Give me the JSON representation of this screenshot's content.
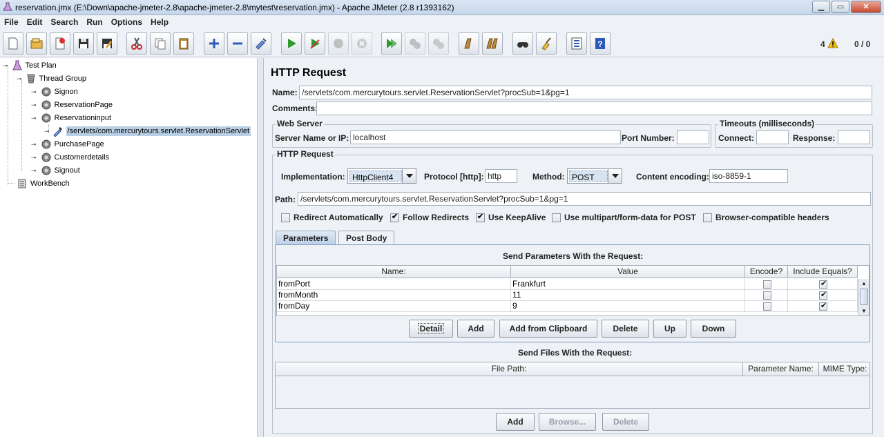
{
  "window": {
    "title": "reservation.jmx (E:\\Down\\apache-jmeter-2.8\\apache-jmeter-2.8\\mytest\\reservation.jmx) - Apache JMeter (2.8 r1393162)",
    "minimize": "▁",
    "maximize": "▭",
    "close": "✕"
  },
  "menu": [
    "File",
    "Edit",
    "Search",
    "Run",
    "Options",
    "Help"
  ],
  "toolbar": {
    "warnings_count": "4",
    "threads_status": "0 / 0",
    "icons": [
      "new-icon",
      "open-icon",
      "close-icon",
      "save-icon",
      "save-as-icon",
      "cut-icon",
      "copy-icon",
      "paste-icon",
      "expand-icon",
      "collapse-icon",
      "toggle-icon",
      "start-icon",
      "start-no-timers-icon",
      "stop-icon",
      "shutdown-icon",
      "remote-start-icon",
      "remote-stop-icon",
      "remote-shutdown-icon",
      "clear-icon",
      "clear-all-icon",
      "search-icon",
      "reset-search-icon",
      "function-helper-icon",
      "help-icon"
    ],
    "accent_green": "#2e9a2e",
    "accent_blue": "#2a5bb8"
  },
  "tree": {
    "items": [
      {
        "label": "Test Plan"
      },
      {
        "label": "Thread Group"
      },
      {
        "label": "Signon"
      },
      {
        "label": "ReservationPage"
      },
      {
        "label": "Reservationinput"
      },
      {
        "label": "/servlets/com.mercurytours.servlet.ReservationServlet"
      },
      {
        "label": "PurchasePage"
      },
      {
        "label": "Customerdetails"
      },
      {
        "label": "Signout"
      },
      {
        "label": "WorkBench"
      }
    ],
    "selected": "/servlets/com.mercurytours.servlet.ReservationServlet"
  },
  "panel": {
    "title": "HTTP Request",
    "name_label": "Name:",
    "name_value": "/servlets/com.mercurytours.servlet.ReservationServlet?procSub=1&pg=1",
    "comments_label": "Comments:",
    "comments_value": "",
    "web_server": {
      "title": "Web Server",
      "server_label": "Server Name or IP:",
      "server_value": "localhost",
      "port_label": "Port Number:",
      "port_value": ""
    },
    "timeouts": {
      "title": "Timeouts (milliseconds)",
      "connect_label": "Connect:",
      "connect_value": "",
      "response_label": "Response:",
      "response_value": ""
    },
    "http_request": {
      "title": "HTTP Request",
      "implementation_label": "Implementation:",
      "implementation_value": "HttpClient4",
      "protocol_label": "Protocol [http]:",
      "protocol_value": "http",
      "method_label": "Method:",
      "method_value": "POST",
      "encoding_label": "Content encoding:",
      "encoding_value": "iso-8859-1",
      "path_label": "Path:",
      "path_value": "/servlets/com.mercurytours.servlet.ReservationServlet?procSub=1&pg=1"
    },
    "options": [
      {
        "label": "Redirect Automatically",
        "checked": false
      },
      {
        "label": "Follow Redirects",
        "checked": true
      },
      {
        "label": "Use KeepAlive",
        "checked": true
      },
      {
        "label": "Use multipart/form-data for POST",
        "checked": false
      },
      {
        "label": "Browser-compatible headers",
        "checked": false
      }
    ],
    "tabs": [
      "Parameters",
      "Post Body"
    ],
    "params": {
      "title": "Send Parameters With the Request:",
      "columns": [
        "Name:",
        "Value",
        "Encode?",
        "Include Equals?"
      ],
      "rows": [
        {
          "name": "fromPort",
          "value": "Frankfurt",
          "encode": false,
          "include_equals": true
        },
        {
          "name": "fromMonth",
          "value": "11",
          "encode": false,
          "include_equals": true
        },
        {
          "name": "fromDay",
          "value": "9",
          "encode": false,
          "include_equals": true
        }
      ],
      "buttons": [
        "Detail",
        "Add",
        "Add from Clipboard",
        "Delete",
        "Up",
        "Down"
      ]
    },
    "files": {
      "title": "Send Files With the Request:",
      "columns": [
        "File Path:",
        "Parameter Name:",
        "MIME Type:"
      ],
      "buttons": [
        "Add",
        "Browse...",
        "Delete"
      ]
    }
  }
}
